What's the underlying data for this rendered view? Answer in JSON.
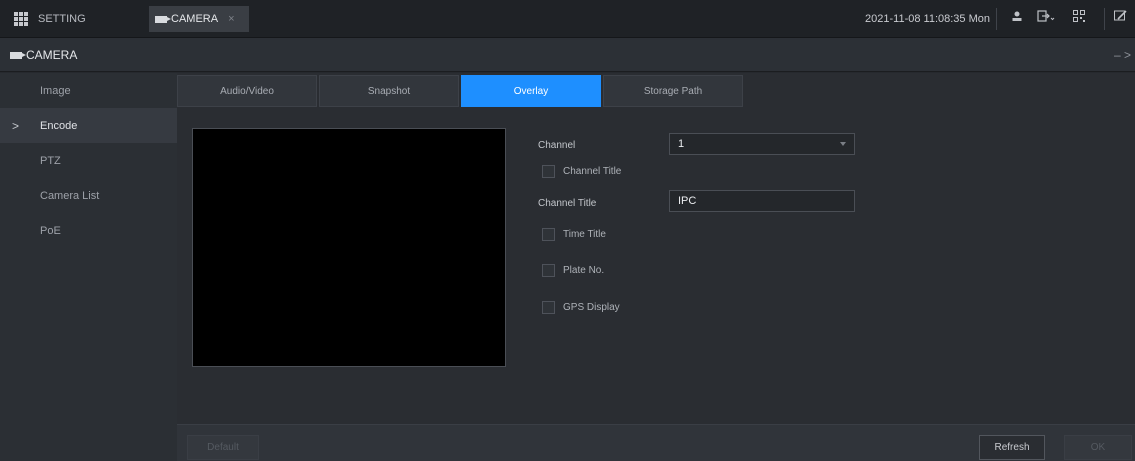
{
  "topbar": {
    "setting_tab": "SETTING",
    "camera_tab": "CAMERA",
    "close_glyph": "×",
    "datetime": "2021-11-08 11:08:35 Mon"
  },
  "subbar": {
    "title": "CAMERA",
    "minimize_glyph": "– >"
  },
  "sidebar": {
    "items": [
      {
        "label": "Image"
      },
      {
        "label": "Encode"
      },
      {
        "label": "PTZ"
      },
      {
        "label": "Camera List"
      },
      {
        "label": "PoE"
      }
    ],
    "active_arrow": ">"
  },
  "tabs": [
    {
      "label": "Audio/Video"
    },
    {
      "label": "Snapshot"
    },
    {
      "label": "Overlay"
    },
    {
      "label": "Storage Path"
    }
  ],
  "form": {
    "channel_label": "Channel",
    "channel_value": "1",
    "channel_title_checkbox": "Channel Title",
    "channel_title_label": "Channel Title",
    "channel_title_value": "IPC",
    "time_title_checkbox": "Time Title",
    "plate_no_checkbox": "Plate No.",
    "gps_display_checkbox": "GPS Display"
  },
  "footer": {
    "default_label": "Default",
    "refresh_label": "Refresh",
    "ok_label": "OK"
  },
  "colors": {
    "accent": "#1e8fff",
    "background": "#26292e"
  }
}
